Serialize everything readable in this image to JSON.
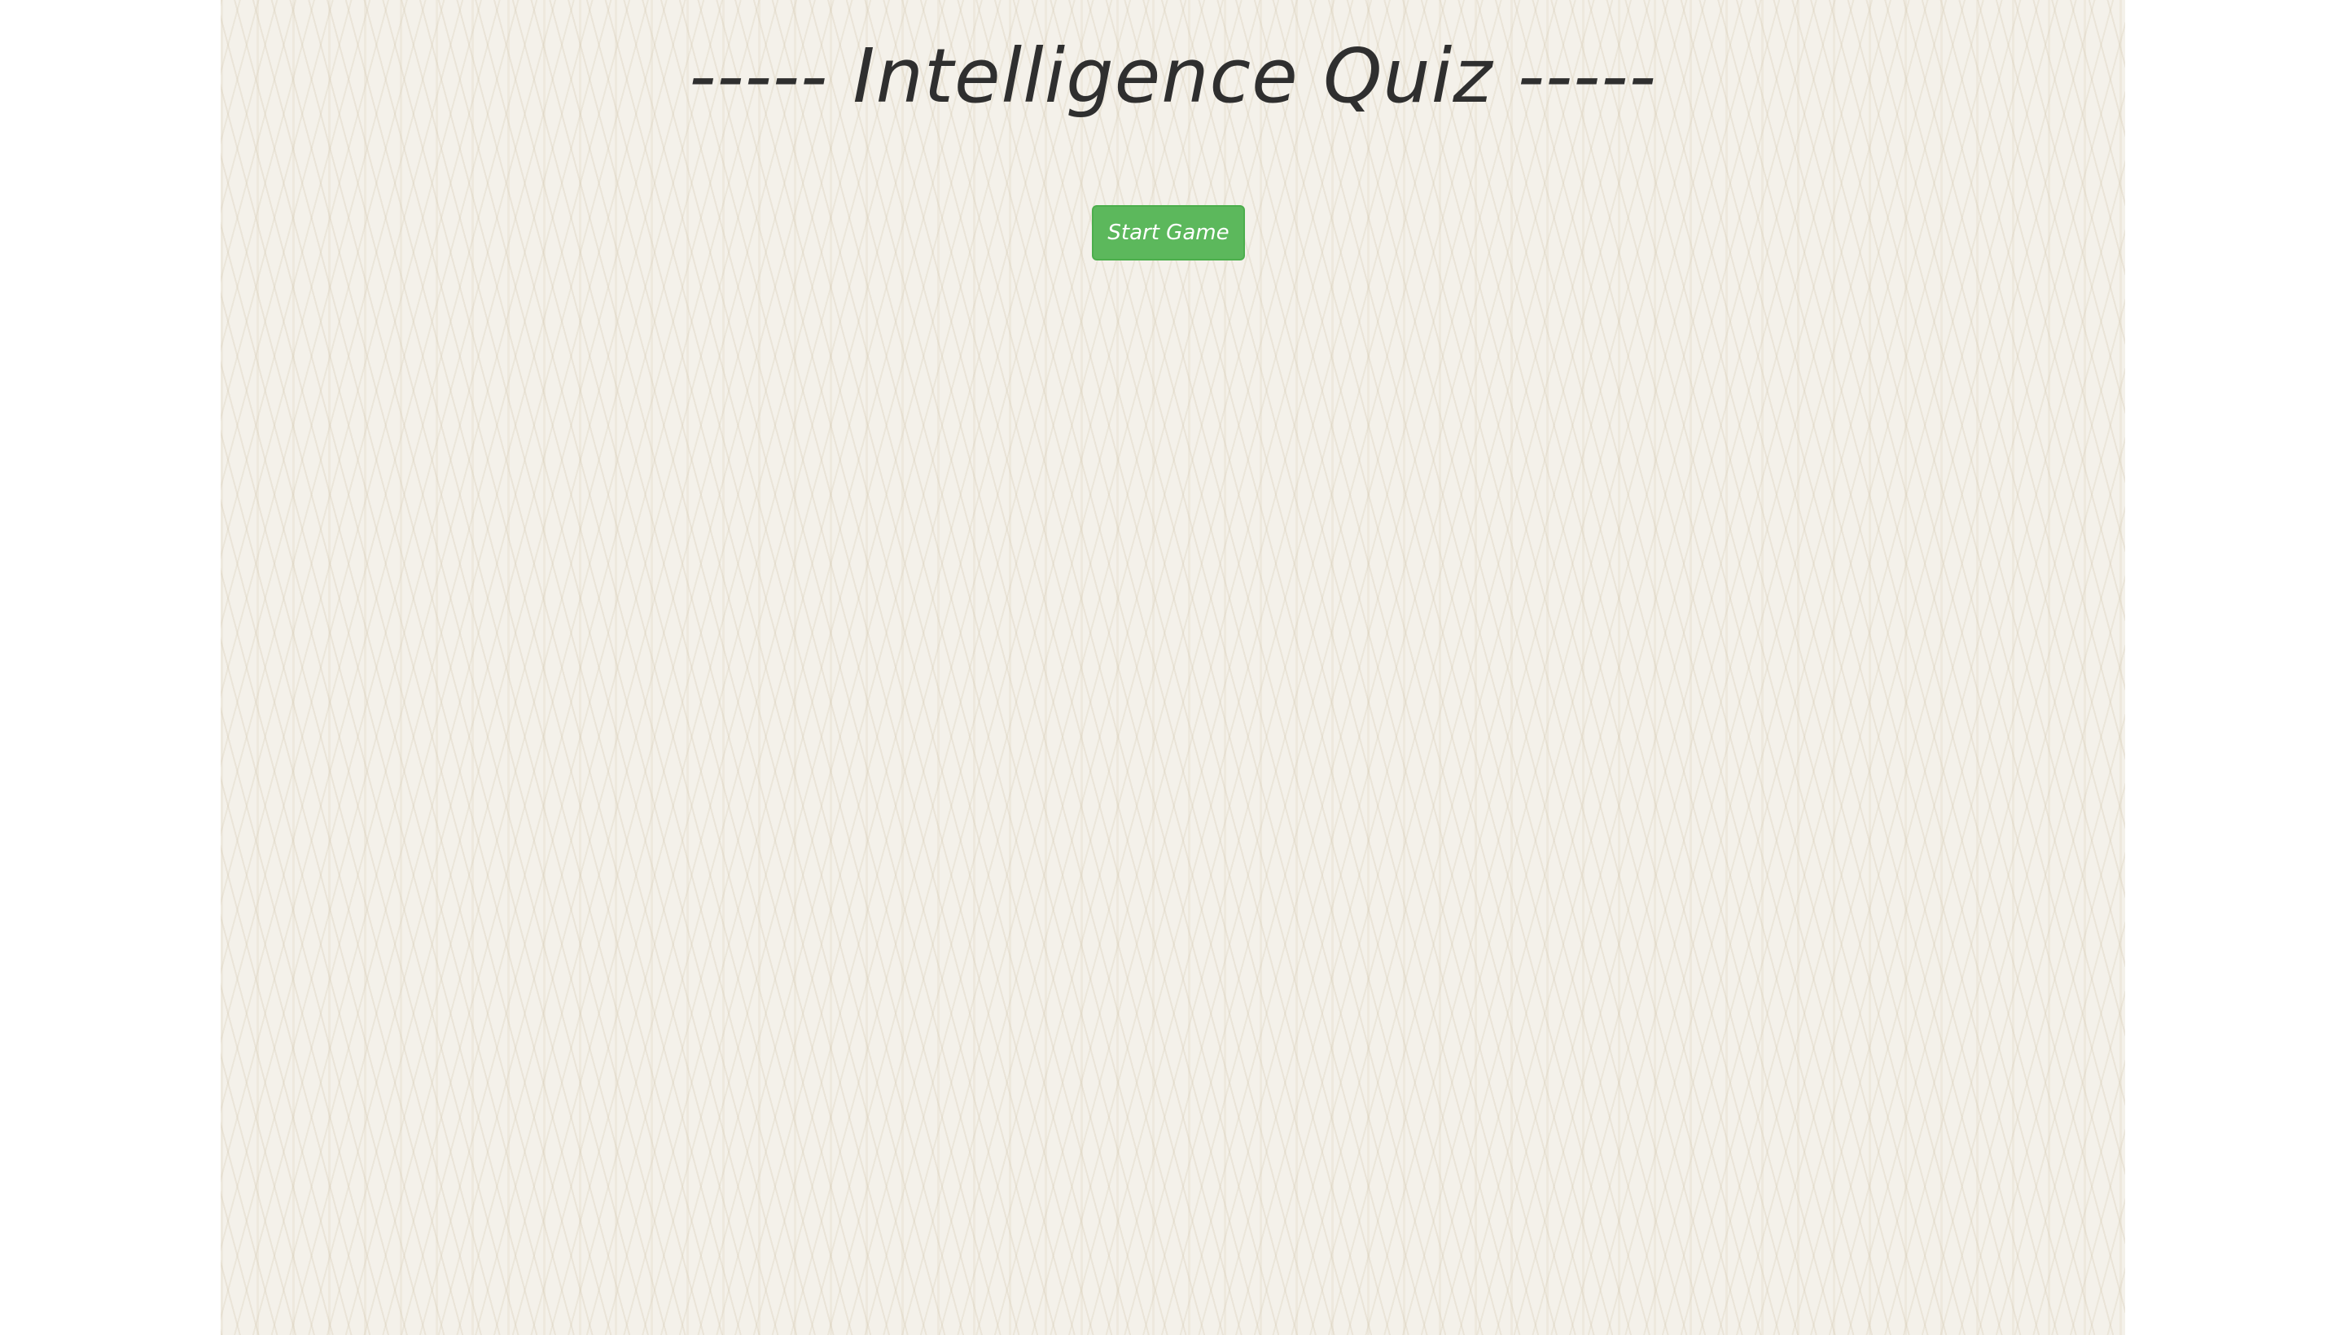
{
  "quiz": {
    "title": "----- Intelligence Quiz -----",
    "start_button_label": "Start Game"
  },
  "colors": {
    "background_pattern": "#f4f1ea",
    "title_text": "#2f2f2f",
    "start_button": "#5cb85c",
    "start_button_border": "#4cae4c",
    "start_button_text": "#ffffff"
  }
}
